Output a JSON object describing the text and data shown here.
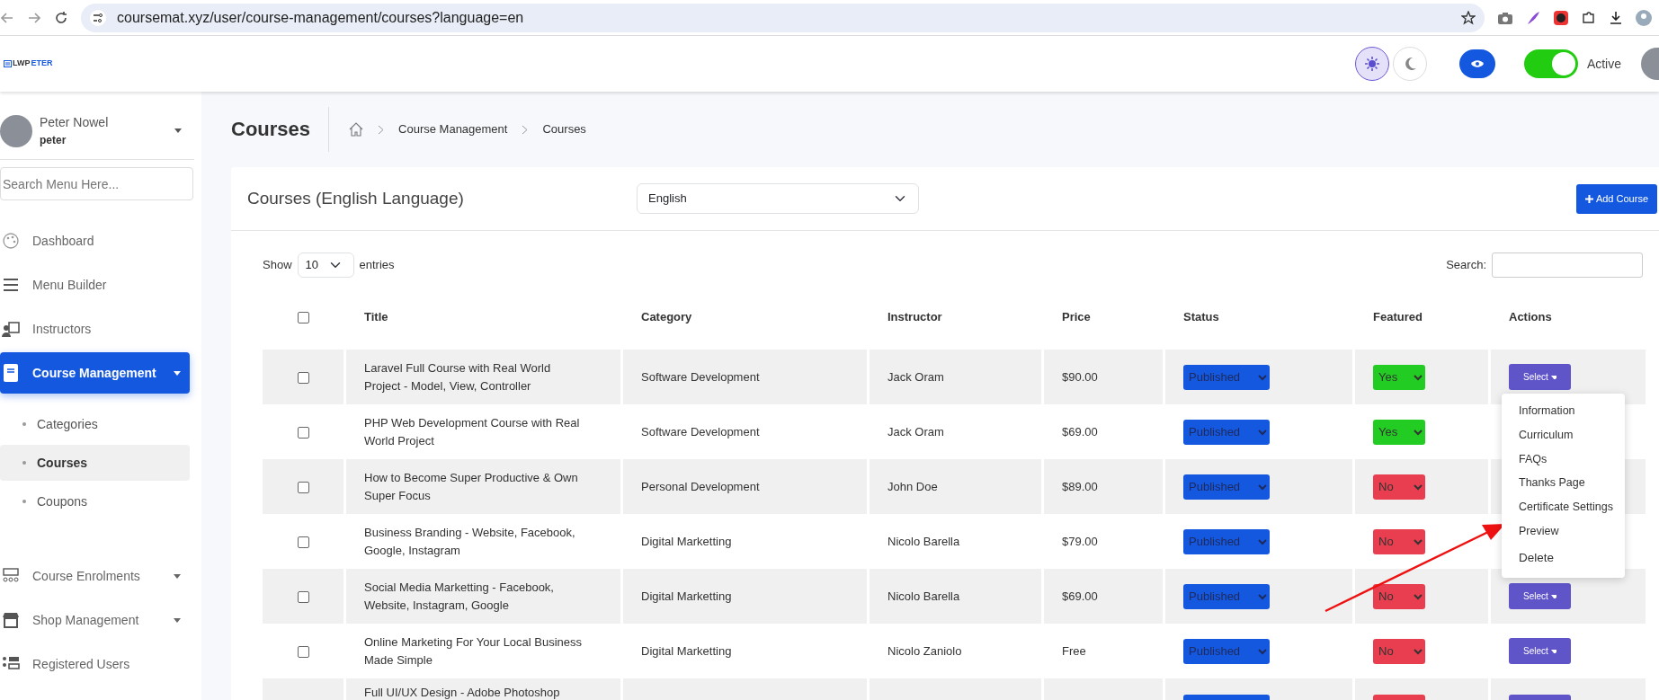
{
  "browser": {
    "url": "coursemat.xyz/user/course-management/courses?language=en"
  },
  "header": {
    "logo": [
      "LWP",
      "ETER"
    ],
    "theme_buttons": [
      {
        "kind": "light",
        "selected": true
      },
      {
        "kind": "dark",
        "selected": false
      }
    ],
    "status_toggle": {
      "on": true,
      "label": "Active"
    }
  },
  "sidebar": {
    "user": {
      "name": "Peter Nowel",
      "username": "peter"
    },
    "search": {
      "placeholder": "Search Menu Here..."
    },
    "items": [
      {
        "kind": "palette",
        "label": "Dashboard",
        "selected": false,
        "has_submenu": false
      },
      {
        "kind": "menu",
        "label": "Menu Builder",
        "selected": false,
        "has_submenu": false
      },
      {
        "kind": "instructor",
        "label": "Instructors",
        "selected": false,
        "has_submenu": false
      },
      {
        "kind": "book",
        "label": "Course Management",
        "selected": true,
        "has_submenu": true,
        "expanded": true,
        "children": [
          {
            "label": "Categories",
            "selected": false
          },
          {
            "label": "Courses",
            "selected": true
          },
          {
            "label": "Coupons",
            "selected": false
          }
        ]
      },
      {
        "kind": "group",
        "label": "Course Enrolments",
        "selected": false,
        "has_submenu": true
      },
      {
        "kind": "shop",
        "label": "Shop Management",
        "selected": false,
        "has_submenu": true
      },
      {
        "kind": "users",
        "label": "Registered Users",
        "selected": false,
        "has_submenu": false
      }
    ]
  },
  "page": {
    "title": "Courses",
    "breadcrumb": [
      "Course Management",
      "Courses"
    ]
  },
  "card": {
    "title": "Courses (English Language)",
    "language": "English",
    "add_button": "Add Course",
    "show_label": "Show",
    "page_size": "10",
    "entries_label": "entries",
    "search_label": "Search:",
    "select_all_checked": false,
    "columns": [
      "Title",
      "Category",
      "Instructor",
      "Price",
      "Status",
      "Featured",
      "Actions"
    ],
    "rows": [
      {
        "checked": false,
        "title": "Laravel Full Course with Real World Project - Model, View, Controller",
        "category": "Software Development",
        "instructor": "Jack Oram",
        "price": "$90.00",
        "status": "Published",
        "featured": true,
        "featured_label": "Yes",
        "action": "Select",
        "menu_open": true
      },
      {
        "checked": false,
        "title": "PHP Web Development Course with Real World Project",
        "category": "Software Development",
        "instructor": "Jack Oram",
        "price": "$69.00",
        "status": "Published",
        "featured": true,
        "featured_label": "Yes"
      },
      {
        "checked": false,
        "title": "How to Become Super Productive & Own Super Focus",
        "category": "Personal Development",
        "instructor": "John Doe",
        "price": "$89.00",
        "status": "Published",
        "featured": false,
        "featured_label": "No"
      },
      {
        "checked": false,
        "title": "Business Branding - Website, Facebook, Google, Instagram",
        "category": "Digital Marketting",
        "instructor": "Nicolo Barella",
        "price": "$79.00",
        "status": "Published",
        "featured": false,
        "featured_label": "No"
      },
      {
        "checked": false,
        "title": "Social Media Marketting - Facebook, Website, Instagram, Google",
        "category": "Digital Marketting",
        "instructor": "Nicolo Barella",
        "price": "$69.00",
        "status": "Published",
        "featured": false,
        "featured_label": "No",
        "action": "Select"
      },
      {
        "checked": false,
        "title": "Online Marketing For Your Local Business Made Simple",
        "category": "Digital Marketting",
        "instructor": "Nicolo Zaniolo",
        "price": "Free",
        "status": "Published",
        "featured": false,
        "featured_label": "No",
        "action": "Select"
      },
      {
        "partial": true,
        "title": "Full UI/UX Design - Adobe Photoshop",
        "featured": false
      }
    ],
    "menu": {
      "items": [
        "Information",
        "Curriculum",
        "FAQs",
        "Thanks Page",
        "Certificate Settings",
        "Preview",
        "Delete"
      ]
    }
  }
}
